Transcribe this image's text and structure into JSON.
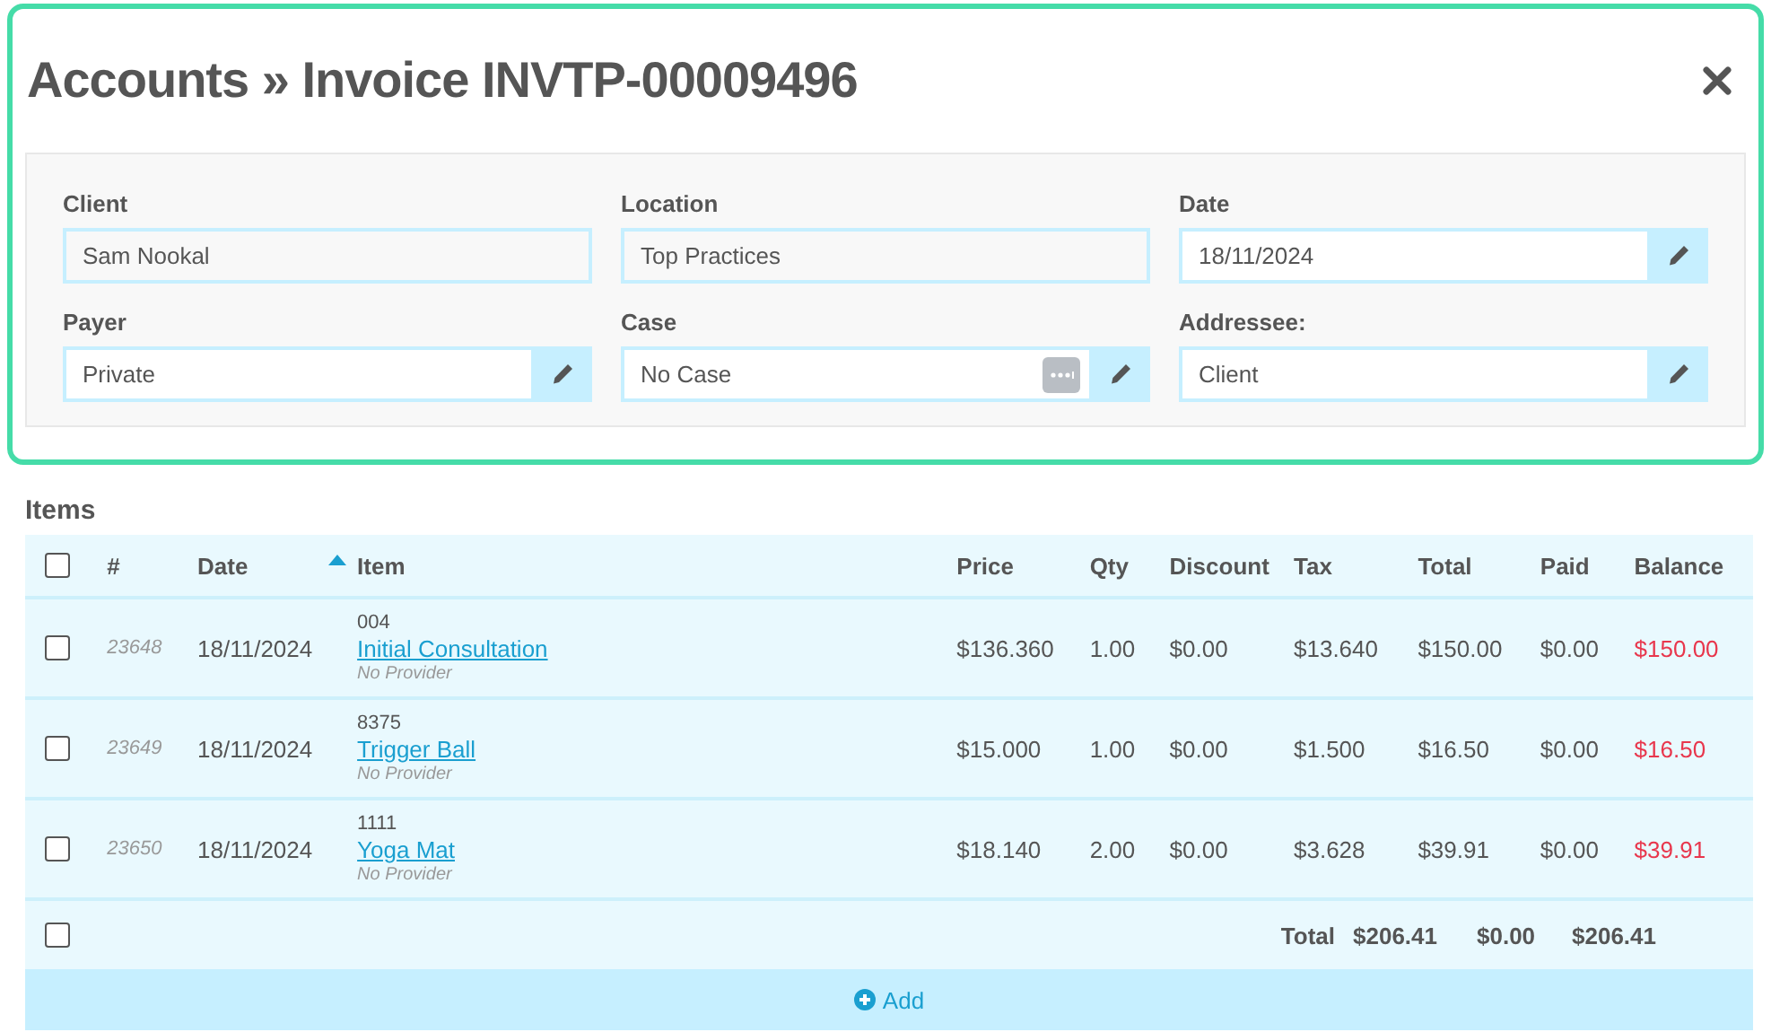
{
  "title": "Accounts » Invoice INVTP-00009496",
  "fields": [
    {
      "label": "Client",
      "value": "Sam Nookal",
      "kind": "plain"
    },
    {
      "label": "Location",
      "value": "Top Practices",
      "kind": "plain"
    },
    {
      "label": "Date",
      "value": "18/11/2024",
      "kind": "edit"
    },
    {
      "label": "Payer",
      "value": "Private",
      "kind": "edit"
    },
    {
      "label": "Case",
      "value": "No Case",
      "kind": "lookup"
    },
    {
      "label": "Addressee:",
      "value": "Client",
      "kind": "edit"
    }
  ],
  "items": {
    "heading": "Items",
    "all_checked": false,
    "columns": [
      {
        "label": "#",
        "sorted": false
      },
      {
        "label": "Date",
        "sorted": true
      },
      {
        "label": "Item",
        "sorted": false
      },
      {
        "label": "Price",
        "sorted": false
      },
      {
        "label": "Qty",
        "sorted": false
      },
      {
        "label": "Discount",
        "sorted": false
      },
      {
        "label": "Tax",
        "sorted": false
      },
      {
        "label": "Total",
        "sorted": false
      },
      {
        "label": "Paid",
        "sorted": false
      },
      {
        "label": "Balance",
        "sorted": false
      }
    ],
    "rows": [
      {
        "checked": false,
        "number": "23648",
        "date": "18/11/2024",
        "code": "004",
        "item": "Initial Consultation",
        "provider": "No Provider",
        "price": "$136.360",
        "qty": "1.00",
        "discount": "$0.00",
        "tax": "$13.640",
        "total": "$150.00",
        "paid": "$0.00",
        "balance": "$150.00"
      },
      {
        "checked": false,
        "number": "23649",
        "date": "18/11/2024",
        "code": "8375",
        "item": "Trigger Ball",
        "provider": "No Provider",
        "price": "$15.000",
        "qty": "1.00",
        "discount": "$0.00",
        "tax": "$1.500",
        "total": "$16.50",
        "paid": "$0.00",
        "balance": "$16.50"
      },
      {
        "checked": false,
        "number": "23650",
        "date": "18/11/2024",
        "code": "1111",
        "item": "Yoga Mat",
        "provider": "No Provider",
        "price": "$18.140",
        "qty": "2.00",
        "discount": "$0.00",
        "tax": "$3.628",
        "total": "$39.91",
        "paid": "$0.00",
        "balance": "$39.91"
      }
    ],
    "totals": {
      "checked": false,
      "label": "Total",
      "total": "$206.41",
      "paid": "$0.00",
      "balance": "$206.41"
    },
    "add_label": "Add"
  }
}
